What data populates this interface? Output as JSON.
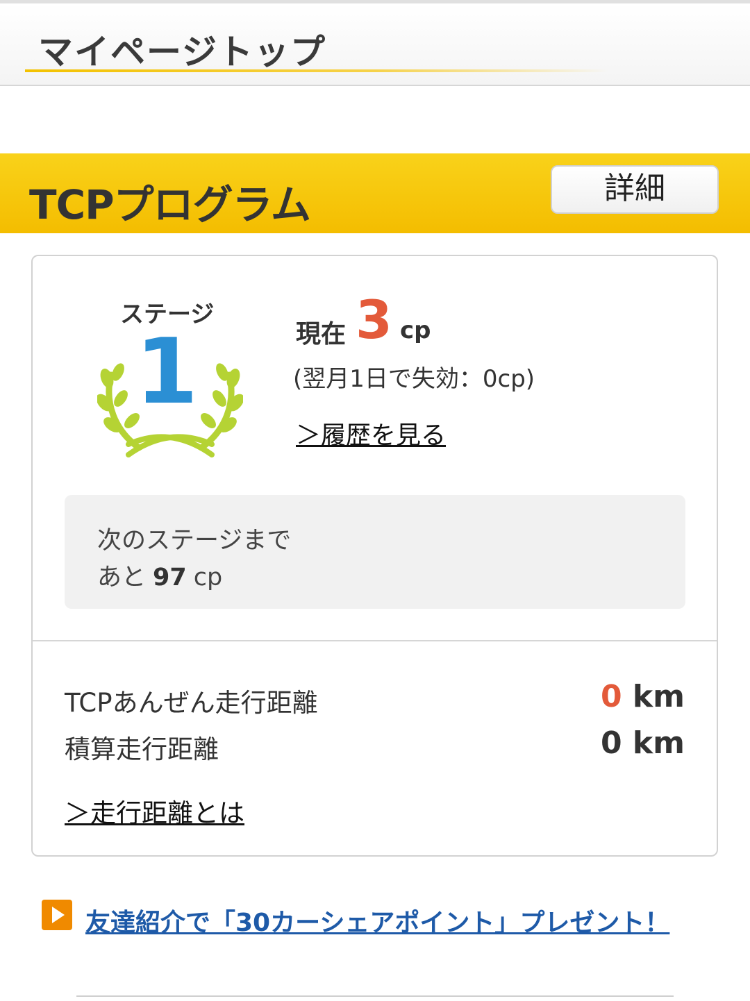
{
  "header": {
    "title": "マイページトップ"
  },
  "tcp_program": {
    "title": "TCPプログラム",
    "detail_button": "詳細",
    "stage": {
      "label": "ステージ",
      "number": "1"
    },
    "current": {
      "label": "現在",
      "value": "3",
      "unit": "cp"
    },
    "expire_note": "(翌月1日で失効：0cp)",
    "history_link": "＞履歴を見る",
    "next_stage": {
      "line1": "次のステージまで",
      "prefix": "あと",
      "value": "97",
      "unit": "cp"
    },
    "distances": [
      {
        "label": "TCPあんぜん走行距離",
        "value": "0",
        "unit": "km",
        "value_color": "#e35a3a"
      },
      {
        "label": "積算走行距離",
        "value": "0",
        "unit": "km",
        "value_color": "#333333"
      }
    ],
    "distance_link": "＞走行距離とは"
  },
  "promo": {
    "link_text": "友達紹介で「30カーシェアポイント」プレゼント！"
  },
  "colors": {
    "accent_yellow": "#f4bd00",
    "highlight_orange": "#e35a3a",
    "stage_blue": "#2b8fd4",
    "laurel_green": "#b5d334",
    "link_blue": "#1e5aa8"
  }
}
